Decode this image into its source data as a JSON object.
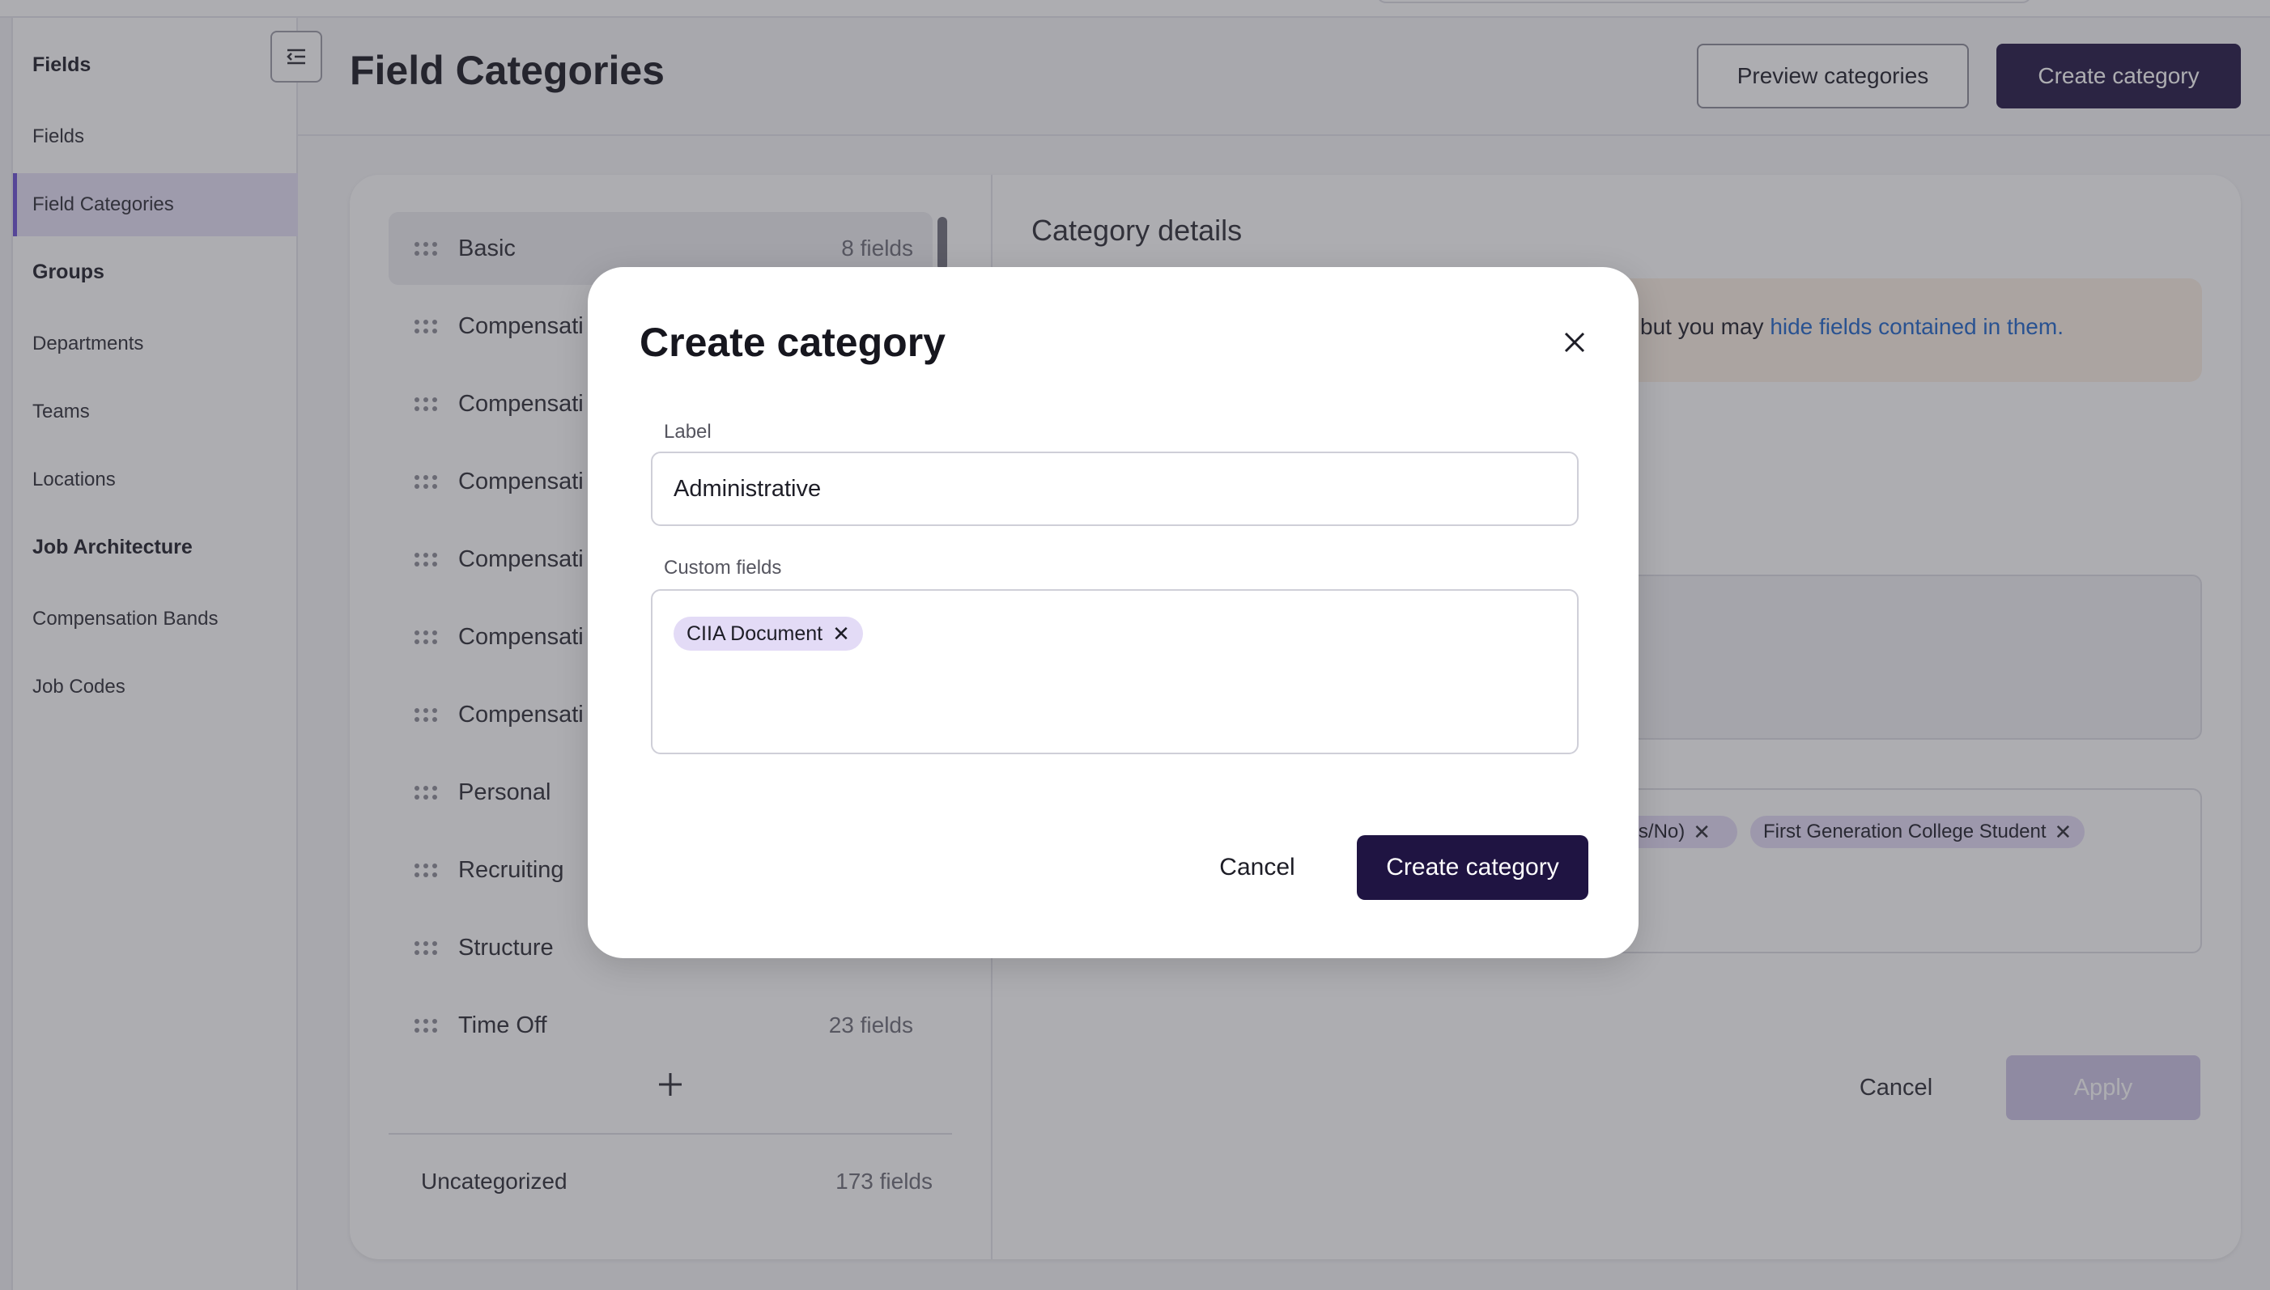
{
  "header": {
    "title": "Field Categories",
    "preview_label": "Preview categories",
    "create_label": "Create category"
  },
  "sidebar": {
    "sections": [
      {
        "heading": "Fields",
        "items": [
          "Fields",
          "Field Categories"
        ]
      },
      {
        "heading": "Groups",
        "items": [
          "Departments",
          "Teams",
          "Locations"
        ]
      },
      {
        "heading": "Job Architecture",
        "items": [
          "Compensation Bands",
          "Job Codes"
        ]
      }
    ],
    "active_item": "Field Categories"
  },
  "categories": {
    "items": [
      {
        "name": "Basic",
        "count": "8 fields"
      },
      {
        "name": "Compensati",
        "count": ""
      },
      {
        "name": "Compensati",
        "count": ""
      },
      {
        "name": "Compensati",
        "count": ""
      },
      {
        "name": "Compensati",
        "count": ""
      },
      {
        "name": "Compensati",
        "count": ""
      },
      {
        "name": "Compensati",
        "count": ""
      },
      {
        "name": "Personal",
        "count": ""
      },
      {
        "name": "Recruiting",
        "count": ""
      },
      {
        "name": "Structure",
        "count": ""
      },
      {
        "name": "Time Off",
        "count": "23 fields"
      }
    ],
    "uncategorized": {
      "label": "Uncategorized",
      "count": "173 fields"
    }
  },
  "details": {
    "title": "Category details",
    "banner_text": "but you may ",
    "banner_link": "hide fields contained in them.",
    "chips": [
      "'es/No)",
      "First Generation College Student"
    ],
    "cancel_label": "Cancel",
    "apply_label": "Apply"
  },
  "modal": {
    "title": "Create category",
    "label_field": {
      "label": "Label",
      "value": "Administrative"
    },
    "custom_fields": {
      "label": "Custom fields",
      "tags": [
        "CIIA Document"
      ]
    },
    "cancel_label": "Cancel",
    "create_label": "Create category"
  },
  "colors": {
    "primary": "#1f1442",
    "active_nav": "#e6e0f7",
    "accent": "#6a4fd3",
    "chip": "#e3dbf6",
    "link": "#1d63c8",
    "banner": "#fbf0e4"
  }
}
